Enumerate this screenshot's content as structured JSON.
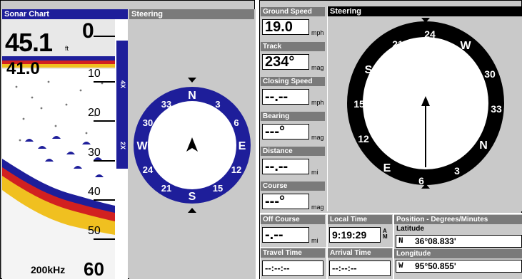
{
  "left_screen": {
    "sonar": {
      "title": "Sonar Chart",
      "depth_big": "45.1",
      "depth_unit": "ft",
      "depth_small": "41.0",
      "scale_labels": [
        "0",
        "10",
        "20",
        "30",
        "40",
        "50",
        "60"
      ],
      "frequency": "200kHz",
      "zoom_labels": [
        "4X",
        "2X"
      ]
    },
    "steering": {
      "title": "Steering",
      "compass_labels": [
        "N",
        "3",
        "6",
        "E",
        "12",
        "15",
        "S",
        "21",
        "24",
        "W",
        "30",
        "33"
      ]
    }
  },
  "right_screen": {
    "fields": [
      {
        "label": "Ground Speed",
        "value": "19.0",
        "unit": "mph"
      },
      {
        "label": "Track",
        "value": "234°",
        "unit": "mag"
      },
      {
        "label": "Closing Speed",
        "value": "--.--",
        "unit": "mph"
      },
      {
        "label": "Bearing",
        "value": "---°",
        "unit": "mag"
      },
      {
        "label": "Distance",
        "value": "--.--",
        "unit": "mi"
      },
      {
        "label": "Course",
        "value": "---°",
        "unit": "mag"
      }
    ],
    "steering": {
      "title": "Steering",
      "compass_labels": [
        "24",
        "W",
        "30",
        "33",
        "N",
        "3",
        "6",
        "E",
        "12",
        "15",
        "S",
        "21"
      ]
    },
    "bottom": {
      "off_course": {
        "label": "Off Course",
        "value": "-.--",
        "unit": "mi"
      },
      "local_time": {
        "label": "Local Time",
        "value": "9:19:29",
        "ampm": "AM"
      },
      "travel_time": {
        "label": "Travel Time",
        "value": "--:--:--"
      },
      "arrival_time": {
        "label": "Arrival Time",
        "value": "--:--:--"
      },
      "position": {
        "title": "Position - Degrees/Minutes",
        "latitude_label": "Latitude",
        "latitude_hemi": "N",
        "latitude_value": "36°08.833'",
        "longitude_label": "Longitude",
        "longitude_hemi": "W",
        "longitude_value": "95°50.855'"
      }
    }
  }
}
